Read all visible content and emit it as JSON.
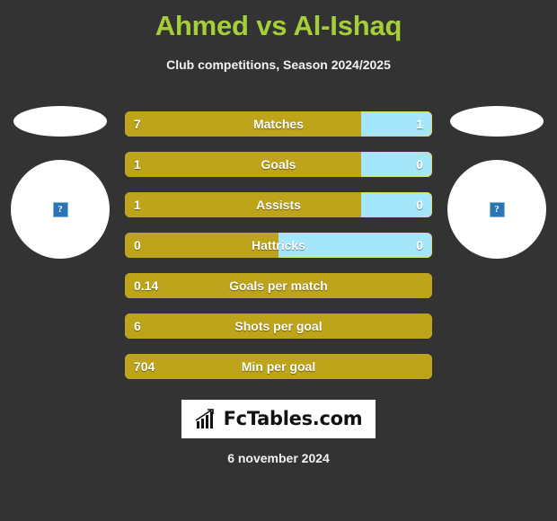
{
  "header": {
    "title": "Ahmed vs Al-Ishaq",
    "subtitle": "Club competitions, Season 2024/2025",
    "title_color": "#a6ce39",
    "subtitle_color": "#f2f2f2"
  },
  "players": {
    "left": {
      "photo_placeholder": "?",
      "flag_placeholder": ""
    },
    "right": {
      "photo_placeholder": "?",
      "flag_placeholder": ""
    }
  },
  "colors": {
    "background": "#333333",
    "player_one_bar": "#bda41a",
    "player_two_bar": "#a5e7fa",
    "bar_border": "#e3d86b",
    "value_text": "#ffffff"
  },
  "chart_data": {
    "type": "bar",
    "title": "Ahmed vs Al-Ishaq",
    "subtitle": "Club competitions, Season 2024/2025",
    "legend": [
      "Ahmed",
      "Al-Ishaq"
    ],
    "categories": [
      "Matches",
      "Goals",
      "Assists",
      "Hattricks",
      "Goals per match",
      "Shots per goal",
      "Min per goal"
    ],
    "series": [
      {
        "name": "Ahmed",
        "values": [
          7,
          1,
          1,
          0,
          0.14,
          6,
          704
        ]
      },
      {
        "name": "Al-Ishaq",
        "values": [
          1,
          0,
          0,
          0,
          null,
          null,
          null
        ]
      }
    ],
    "rows": [
      {
        "label": "Matches",
        "left_value": "7",
        "right_value": "1",
        "left_pct": 77,
        "two_sided": true
      },
      {
        "label": "Goals",
        "left_value": "1",
        "right_value": "0",
        "left_pct": 77,
        "two_sided": true
      },
      {
        "label": "Assists",
        "left_value": "1",
        "right_value": "0",
        "left_pct": 77,
        "two_sided": true
      },
      {
        "label": "Hattricks",
        "left_value": "0",
        "right_value": "0",
        "left_pct": 50,
        "two_sided": true
      },
      {
        "label": "Goals per match",
        "left_value": "0.14",
        "right_value": "",
        "left_pct": 100,
        "two_sided": false
      },
      {
        "label": "Shots per goal",
        "left_value": "6",
        "right_value": "",
        "left_pct": 100,
        "two_sided": false
      },
      {
        "label": "Min per goal",
        "left_value": "704",
        "right_value": "",
        "left_pct": 100,
        "two_sided": false
      }
    ],
    "xlabel": "",
    "ylabel": "",
    "grid": false,
    "legend_position": "none"
  },
  "footer": {
    "logo_text": "FcTables.com",
    "logo_icon": "bar-chart-trend-icon",
    "date": "6 november 2024"
  }
}
